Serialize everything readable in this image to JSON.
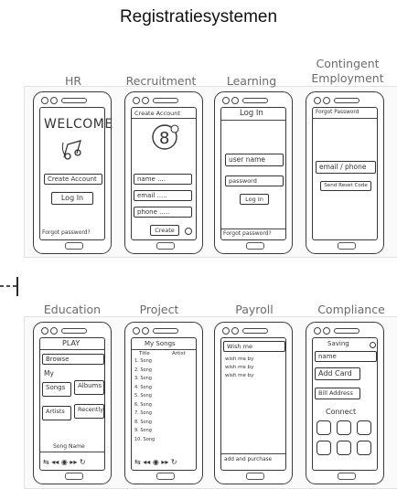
{
  "title": "Registratiesystemen",
  "row1": {
    "labels": [
      "HR",
      "Recruitment",
      "Learning",
      "Contingent Employment"
    ],
    "hr": {
      "heading": "WELCOME",
      "create": "Create Account",
      "login": "Log In",
      "forgot": "Forgot password?"
    },
    "recruitment": {
      "header": "Create Account",
      "name": "name ....",
      "email": "email .....",
      "phone": "phone .....",
      "create": "Create"
    },
    "learning": {
      "header": "Log In",
      "user": "user name",
      "password": "password",
      "login": "Log In",
      "forgot": "Forgot password?"
    },
    "contingent": {
      "header": "Forgot Password",
      "field": "email / phone",
      "send": "Send Reset Code"
    }
  },
  "row2": {
    "labels": [
      "Education",
      "Project",
      "Payroll",
      "Compliance"
    ],
    "education": {
      "header": "PLAY",
      "browse": "Browse",
      "my": "My",
      "songs": "Songs",
      "albums": "Albums",
      "artists": "Artists",
      "recently": "Recently",
      "now": "Song Name"
    },
    "project": {
      "header": "My Songs",
      "col1": "Title",
      "col2": "Artist",
      "rows": [
        "1. Song",
        "2. Song",
        "3. Song",
        "4. Song",
        "5. Song",
        "6. Song",
        "7. Song",
        "8. Song",
        "9. Song",
        "10. Song"
      ]
    },
    "payroll": {
      "header": "Wish me",
      "items": [
        "wish me by",
        "wish me by",
        "wish me by"
      ],
      "footer": "add and purchase"
    },
    "compliance": {
      "header": "Saving",
      "name": "name",
      "card": "Add Card",
      "address": "Bill Address",
      "connect": "Connect"
    }
  }
}
